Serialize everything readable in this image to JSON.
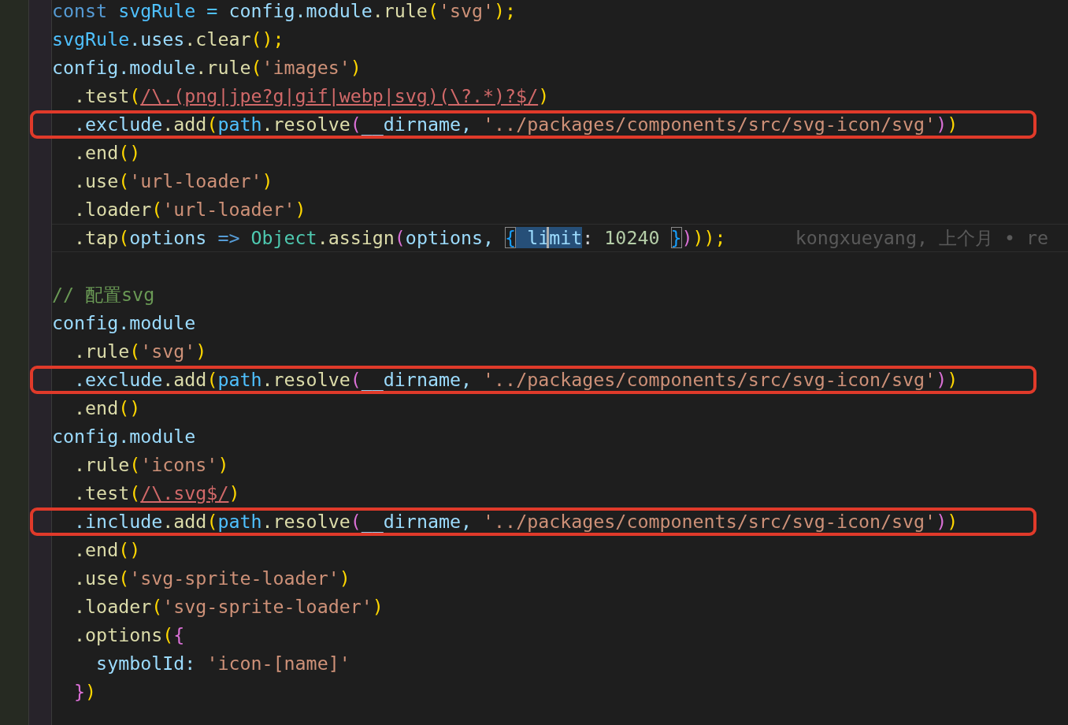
{
  "editor": {
    "lines": [
      {
        "highlighted": false,
        "current": false,
        "tokens": [
          {
            "text": "const ",
            "kind": "keyword"
          },
          {
            "text": "svgRule = ",
            "kind": "constant"
          },
          {
            "text": "config",
            "kind": "variable"
          },
          {
            "text": ".module",
            "kind": "variable"
          },
          {
            "text": ".rule",
            "kind": "function"
          },
          {
            "text": "(",
            "kind": "bracket1"
          },
          {
            "text": "'svg'",
            "kind": "string"
          },
          {
            "text": ");",
            "kind": "bracket1"
          }
        ]
      },
      {
        "highlighted": false,
        "current": false,
        "tokens": [
          {
            "text": "svgRule",
            "kind": "constant"
          },
          {
            "text": ".uses",
            "kind": "variable"
          },
          {
            "text": ".clear",
            "kind": "function"
          },
          {
            "text": "();",
            "kind": "bracket1"
          }
        ]
      },
      {
        "highlighted": false,
        "current": false,
        "tokens": [
          {
            "text": "config",
            "kind": "variable"
          },
          {
            "text": ".module",
            "kind": "variable"
          },
          {
            "text": ".rule",
            "kind": "function"
          },
          {
            "text": "(",
            "kind": "bracket1"
          },
          {
            "text": "'images'",
            "kind": "string"
          },
          {
            "text": ")",
            "kind": "bracket1"
          }
        ]
      },
      {
        "highlighted": false,
        "current": false,
        "tokens": [
          {
            "text": "  .test",
            "kind": "function"
          },
          {
            "text": "(",
            "kind": "bracket1"
          },
          {
            "text": "/\\.(png|jpe?g|gif|webp|svg)(\\?.*)?$/",
            "kind": "regex"
          },
          {
            "text": ")",
            "kind": "bracket1"
          }
        ]
      },
      {
        "highlighted": true,
        "current": false,
        "tokens": [
          {
            "text": "  .exclude",
            "kind": "variable"
          },
          {
            "text": ".add",
            "kind": "function"
          },
          {
            "text": "(",
            "kind": "bracket1"
          },
          {
            "text": "path",
            "kind": "constant"
          },
          {
            "text": ".resolve",
            "kind": "function"
          },
          {
            "text": "(",
            "kind": "bracket2"
          },
          {
            "text": "__dirname, ",
            "kind": "variable"
          },
          {
            "text": "'../packages/components/src/svg-icon/svg'",
            "kind": "string"
          },
          {
            "text": ")",
            "kind": "bracket2"
          },
          {
            "text": ")",
            "kind": "bracket1"
          }
        ]
      },
      {
        "highlighted": false,
        "current": false,
        "tokens": [
          {
            "text": "  .end",
            "kind": "function"
          },
          {
            "text": "()",
            "kind": "bracket1"
          }
        ]
      },
      {
        "highlighted": false,
        "current": false,
        "tokens": [
          {
            "text": "  .use",
            "kind": "function"
          },
          {
            "text": "(",
            "kind": "bracket1"
          },
          {
            "text": "'url-loader'",
            "kind": "string"
          },
          {
            "text": ")",
            "kind": "bracket1"
          }
        ]
      },
      {
        "highlighted": false,
        "current": false,
        "tokens": [
          {
            "text": "  .loader",
            "kind": "function"
          },
          {
            "text": "(",
            "kind": "bracket1"
          },
          {
            "text": "'url-loader'",
            "kind": "string"
          },
          {
            "text": ")",
            "kind": "bracket1"
          }
        ]
      },
      {
        "highlighted": false,
        "current": true,
        "blame": "kongxueyang, 上个月 • re",
        "tokens": [
          {
            "text": "  .tap",
            "kind": "function"
          },
          {
            "text": "(",
            "kind": "bracket1"
          },
          {
            "text": "options ",
            "kind": "variable"
          },
          {
            "text": "=> ",
            "kind": "keyword"
          },
          {
            "text": "Object",
            "kind": "class"
          },
          {
            "text": ".assign",
            "kind": "function"
          },
          {
            "text": "(",
            "kind": "bracket2"
          },
          {
            "text": "options, ",
            "kind": "variable"
          },
          {
            "text": "{",
            "kind": "matched-bracket"
          },
          {
            "text": " li",
            "kind": "selection"
          },
          {
            "text": "mit",
            "kind": "selection-cursor"
          },
          {
            "text": ": ",
            "kind": "punct"
          },
          {
            "text": "10240 ",
            "kind": "number"
          },
          {
            "text": "}",
            "kind": "matched-bracket"
          },
          {
            "text": ")",
            "kind": "bracket2"
          },
          {
            "text": "));",
            "kind": "bracket1"
          }
        ]
      },
      {
        "highlighted": false,
        "current": false
      },
      {
        "highlighted": false,
        "current": false,
        "tokens": [
          {
            "text": "// 配置svg",
            "kind": "comment"
          }
        ]
      },
      {
        "highlighted": false,
        "current": false,
        "tokens": [
          {
            "text": "config",
            "kind": "variable"
          },
          {
            "text": ".module",
            "kind": "variable"
          }
        ]
      },
      {
        "highlighted": false,
        "current": false,
        "tokens": [
          {
            "text": "  .rule",
            "kind": "function"
          },
          {
            "text": "(",
            "kind": "bracket1"
          },
          {
            "text": "'svg'",
            "kind": "string"
          },
          {
            "text": ")",
            "kind": "bracket1"
          }
        ]
      },
      {
        "highlighted": true,
        "current": false,
        "tokens": [
          {
            "text": "  .exclude",
            "kind": "variable"
          },
          {
            "text": ".add",
            "kind": "function"
          },
          {
            "text": "(",
            "kind": "bracket1"
          },
          {
            "text": "path",
            "kind": "constant"
          },
          {
            "text": ".resolve",
            "kind": "function"
          },
          {
            "text": "(",
            "kind": "bracket2"
          },
          {
            "text": "__dirname, ",
            "kind": "variable"
          },
          {
            "text": "'../packages/components/src/svg-icon/svg'",
            "kind": "string"
          },
          {
            "text": ")",
            "kind": "bracket2"
          },
          {
            "text": ")",
            "kind": "bracket1"
          }
        ]
      },
      {
        "highlighted": false,
        "current": false,
        "tokens": [
          {
            "text": "  .end",
            "kind": "function"
          },
          {
            "text": "()",
            "kind": "bracket1"
          }
        ]
      },
      {
        "highlighted": false,
        "current": false,
        "tokens": [
          {
            "text": "config",
            "kind": "variable"
          },
          {
            "text": ".module",
            "kind": "variable"
          }
        ]
      },
      {
        "highlighted": false,
        "current": false,
        "tokens": [
          {
            "text": "  .rule",
            "kind": "function"
          },
          {
            "text": "(",
            "kind": "bracket1"
          },
          {
            "text": "'icons'",
            "kind": "string"
          },
          {
            "text": ")",
            "kind": "bracket1"
          }
        ]
      },
      {
        "highlighted": false,
        "current": false,
        "tokens": [
          {
            "text": "  .test",
            "kind": "function"
          },
          {
            "text": "(",
            "kind": "bracket1"
          },
          {
            "text": "/\\.svg$/",
            "kind": "regex"
          },
          {
            "text": ")",
            "kind": "bracket1"
          }
        ]
      },
      {
        "highlighted": true,
        "current": false,
        "tokens": [
          {
            "text": "  .include",
            "kind": "variable"
          },
          {
            "text": ".add",
            "kind": "function"
          },
          {
            "text": "(",
            "kind": "bracket1"
          },
          {
            "text": "path",
            "kind": "constant"
          },
          {
            "text": ".resolve",
            "kind": "function"
          },
          {
            "text": "(",
            "kind": "bracket2"
          },
          {
            "text": "__dirname, ",
            "kind": "variable"
          },
          {
            "text": "'../packages/components/src/svg-icon/svg'",
            "kind": "string"
          },
          {
            "text": ")",
            "kind": "bracket2"
          },
          {
            "text": ")",
            "kind": "bracket1"
          }
        ]
      },
      {
        "highlighted": false,
        "current": false,
        "tokens": [
          {
            "text": "  .end",
            "kind": "function"
          },
          {
            "text": "()",
            "kind": "bracket1"
          }
        ]
      },
      {
        "highlighted": false,
        "current": false,
        "tokens": [
          {
            "text": "  .use",
            "kind": "function"
          },
          {
            "text": "(",
            "kind": "bracket1"
          },
          {
            "text": "'svg-sprite-loader'",
            "kind": "string"
          },
          {
            "text": ")",
            "kind": "bracket1"
          }
        ]
      },
      {
        "highlighted": false,
        "current": false,
        "tokens": [
          {
            "text": "  .loader",
            "kind": "function"
          },
          {
            "text": "(",
            "kind": "bracket1"
          },
          {
            "text": "'svg-sprite-loader'",
            "kind": "string"
          },
          {
            "text": ")",
            "kind": "bracket1"
          }
        ]
      },
      {
        "highlighted": false,
        "current": false,
        "tokens": [
          {
            "text": "  .options",
            "kind": "function"
          },
          {
            "text": "(",
            "kind": "bracket1"
          },
          {
            "text": "{",
            "kind": "bracket2"
          }
        ]
      },
      {
        "highlighted": false,
        "current": false,
        "tokens": [
          {
            "text": "    symbolId: ",
            "kind": "variable"
          },
          {
            "text": "'icon-[name]'",
            "kind": "string"
          }
        ]
      },
      {
        "highlighted": false,
        "current": false,
        "tokens": [
          {
            "text": "  }",
            "kind": "bracket2"
          },
          {
            "text": ")",
            "kind": "bracket1"
          }
        ]
      }
    ]
  }
}
